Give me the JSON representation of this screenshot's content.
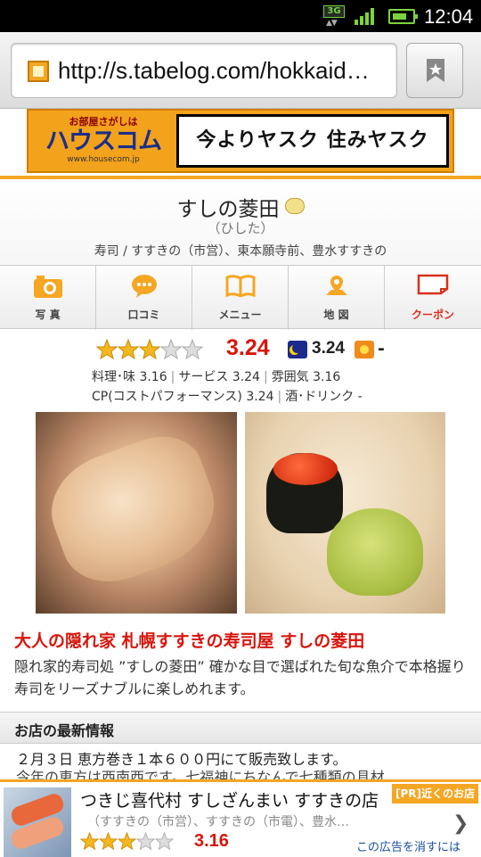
{
  "status_bar": {
    "network": "3G",
    "time": "12:04"
  },
  "browser": {
    "url": "http://s.tabelog.com/hokkaid…",
    "bookmark_icon": "star-bookmark-icon"
  },
  "banner": {
    "small_text": "お部屋さがしは",
    "logo": "ハウスコム",
    "url": "www.housecom.jp",
    "tagline": "今よりヤスク 住みヤスク"
  },
  "shop": {
    "name": "すしの菱田",
    "kana": "（ひした）",
    "category": "寿司 / すすきの（市営）、東本願寺前、豊水すすきの"
  },
  "tabs": [
    {
      "label": "写 真",
      "icon": "camera-icon"
    },
    {
      "label": "口コミ",
      "icon": "speech-bubble-icon"
    },
    {
      "label": "メニュー",
      "icon": "book-icon"
    },
    {
      "label": "地 図",
      "icon": "map-pin-icon"
    },
    {
      "label": "クーポン",
      "icon": "coupon-icon"
    }
  ],
  "rating": {
    "stars": 3,
    "score": "3.24",
    "night_score": "3.24",
    "day_score": "-",
    "details": {
      "taste_label": "料理･味",
      "taste": "3.16",
      "service_label": "サービス",
      "service": "3.24",
      "atmosphere_label": "雰囲気",
      "atmosphere": "3.16",
      "cp_label": "CP(コストパフォーマンス)",
      "cp": "3.24",
      "drink_label": "酒･ドリンク",
      "drink": "-"
    }
  },
  "catch_copy": "大人の隠れ家 札幌すすきの寿司屋 すしの菱田",
  "description": "隠れ家的寿司処 ”すしの菱田” 確かな目で選ばれた旬な魚介で本格握り寿司をリーズナブルに楽しめれます。",
  "news": {
    "heading": "お店の最新情報",
    "line1": "２月３日 恵方巻き１本６００円にて販売致します。",
    "line2": "今年の恵方は西南西です。七福神にちなんで七種類の具材"
  },
  "ad": {
    "name": "つきじ喜代村 すしざんまい すすきの店",
    "pr_label": "[PR]近くのお店",
    "location": "（すすきの（市営）、すすきの（市電）、豊水…",
    "stars": 3,
    "score": "3.16",
    "hide_label": "この広告を消すには"
  },
  "colors": {
    "accent": "#f5a623",
    "score_red": "#d8150c",
    "link_blue": "#1a4fa0"
  }
}
